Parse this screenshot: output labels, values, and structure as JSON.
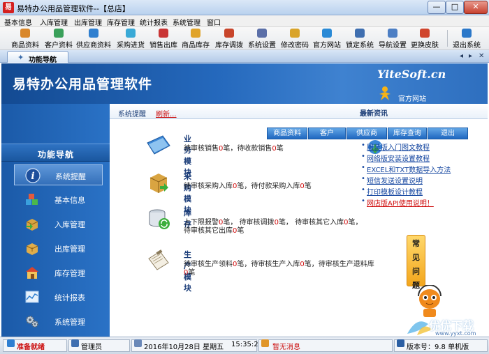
{
  "window": {
    "title": "易特办公用品管理软件--【总店】",
    "app_icon_glyph": "易",
    "min": "—",
    "max": "□",
    "close": "✕"
  },
  "menu": [
    "基本信息",
    "入库管理",
    "出库管理",
    "库存管理",
    "统计报表",
    "系统管理",
    "窗口"
  ],
  "toolbar": {
    "items": [
      {
        "label": "商品资料",
        "icon": "product-icon",
        "color": "#d9872a"
      },
      {
        "label": "客户资料",
        "icon": "customer-icon",
        "color": "#3aa05a"
      },
      {
        "label": "供应商资料",
        "icon": "supplier-icon",
        "color": "#2f7fcf"
      },
      {
        "label": "采购进货",
        "icon": "purchase-icon",
        "color": "#39a9d6"
      },
      {
        "label": "销售出库",
        "icon": "sales-icon",
        "color": "#c93535"
      },
      {
        "label": "商品库存",
        "icon": "stock-icon",
        "color": "#e0a42a"
      },
      {
        "label": "库存调拨",
        "icon": "transfer-icon",
        "color": "#c8452b"
      },
      {
        "label": "系统设置",
        "icon": "settings-icon",
        "color": "#5b6fa8"
      },
      {
        "label": "修改密码",
        "icon": "password-icon",
        "color": "#d9a42a"
      },
      {
        "label": "官方网站",
        "icon": "website-icon",
        "color": "#2a8ad6"
      },
      {
        "label": "锁定系统",
        "icon": "lock-icon",
        "color": "#3f6fb0"
      },
      {
        "label": "导航设置",
        "icon": "navigation-icon",
        "color": "#4d7fc4"
      },
      {
        "label": "更换皮肤",
        "icon": "skin-icon",
        "color": "#d0452d"
      },
      {
        "label": "退出系统",
        "icon": "exit-icon",
        "color": "#2b78c9"
      }
    ]
  },
  "tabstrip": {
    "active_tab": "功能导航",
    "nav_left": "◂",
    "nav_right": "▸",
    "nav_close": "✕"
  },
  "banner": {
    "title": "易特办公用品管理软件",
    "site": "YiteSoft.cn",
    "link": "官方网站"
  },
  "leftnav": {
    "header": "功能导航",
    "items": [
      {
        "label": "系统提醒",
        "icon": "info-icon",
        "active": true
      },
      {
        "label": "基本信息",
        "icon": "cubes-icon",
        "active": false
      },
      {
        "label": "入库管理",
        "icon": "inbound-box-icon",
        "active": false
      },
      {
        "label": "出库管理",
        "icon": "outbound-box-icon",
        "active": false
      },
      {
        "label": "库存管理",
        "icon": "warehouse-icon",
        "active": false
      },
      {
        "label": "统计报表",
        "icon": "report-chart-icon",
        "active": false
      },
      {
        "label": "系统管理",
        "icon": "gears-icon",
        "active": false
      }
    ]
  },
  "content": {
    "tab_remind": "系统提醒",
    "tab_refresh": "刷新...",
    "tab_news": "最新资讯",
    "quick_buttons": [
      "商品资料",
      "客户",
      "供应商",
      "库存查询",
      "退出"
    ],
    "modules": [
      {
        "title": "业务模块",
        "lines": [
          [
            "待审核销售",
            "0",
            "笔，待收款销售",
            "0",
            "笔"
          ]
        ]
      },
      {
        "title": "采购模块",
        "lines": [
          [
            "待审核采购入库",
            "0",
            "笔，待付款采购入库",
            "0",
            "笔"
          ]
        ]
      },
      {
        "title": "库存",
        "lines": [
          [
            "上下限报警",
            "0",
            "笔，  待审核调拨",
            "0",
            "笔，  待审核其它入库",
            "0",
            "笔，"
          ],
          [
            "待审核其它出库",
            "0",
            "笔"
          ]
        ]
      },
      {
        "title": "生产模块",
        "lines": [
          [
            "待审核生产领料",
            "0",
            "笔，待审核生产入库",
            "0",
            "笔，待审核生产退料库"
          ],
          [
            "",
            "0",
            "笔"
          ]
        ]
      }
    ],
    "news": [
      {
        "text": "服装版入门图文教程",
        "red": false
      },
      {
        "text": "网络版安装设置教程",
        "red": false
      },
      {
        "text": "EXCEL和TXT数据导入方法",
        "red": false
      },
      {
        "text": "短信发送设置说明",
        "red": false
      },
      {
        "text": "打印模板设计教程",
        "red": false
      },
      {
        "text": "网店版API使用说明！",
        "red": true
      }
    ],
    "faq": [
      "常",
      "见",
      "问",
      "题"
    ],
    "watermark": "优优下载",
    "watermark_url": "www.yyxt.com"
  },
  "statusbar": {
    "status": "准备就绪",
    "user": "管理员",
    "date": "2016年10月28日 星期五",
    "time": "15:35:27",
    "message": "暂无消息",
    "version": "版本号：9.8 单机版"
  }
}
